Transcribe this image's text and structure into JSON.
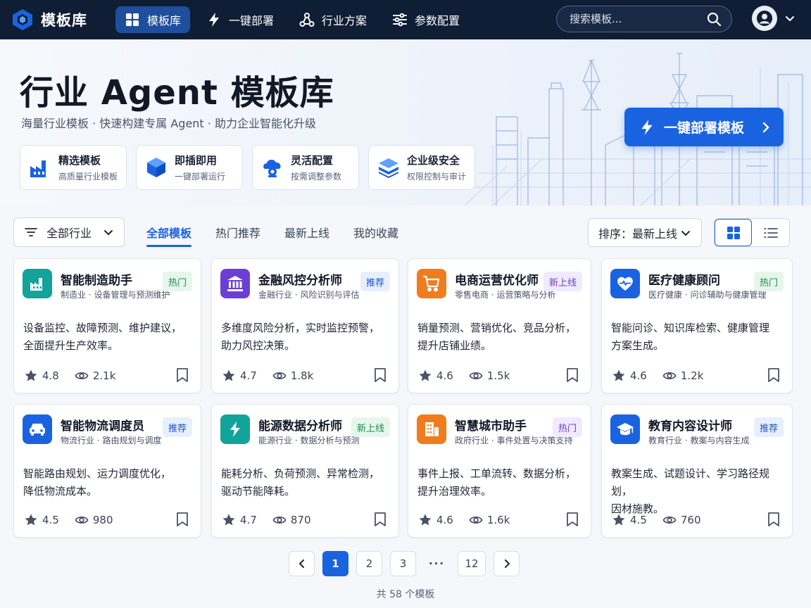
{
  "nav": {
    "brand": "模板库",
    "items": [
      {
        "label": "模板库",
        "icon": "grid-icon",
        "active": true
      },
      {
        "label": "一键部署",
        "icon": "bolt-icon",
        "active": false
      },
      {
        "label": "行业方案",
        "icon": "network-icon",
        "active": false
      },
      {
        "label": "参数配置",
        "icon": "sliders-icon",
        "active": false
      }
    ],
    "search_placeholder": "搜索模板..."
  },
  "hero": {
    "title": "行业 Agent 模板库",
    "subtitle": "海量行业模板 · 快速构建专属 Agent · 助力企业智能化升级",
    "cta": "一键部署模板",
    "features": [
      {
        "title": "精选模板",
        "desc": "高质量行业模板",
        "icon": "factory-icon"
      },
      {
        "title": "即插即用",
        "desc": "一键部署运行",
        "icon": "cube-icon"
      },
      {
        "title": "灵活配置",
        "desc": "按需调整参数",
        "icon": "settings-cloud-icon"
      },
      {
        "title": "企业级安全",
        "desc": "权限控制与审计",
        "icon": "layers-shield-icon"
      }
    ]
  },
  "filters": {
    "industry": "全部行业",
    "tabs": [
      "全部模板",
      "热门推荐",
      "最新上线",
      "我的收藏"
    ],
    "active_tab": 0,
    "sort": "排序：最新上线",
    "view": "grid"
  },
  "cards": [
    {
      "name": "智能制造助手",
      "category": "制造业 · 设备管理与预测维护",
      "badge": "热门",
      "desc1": "设备监控、故障预测、维护建议，",
      "desc2": "全面提升生产效率。",
      "rating": "4.8",
      "views": "2.1k",
      "icon": "factory-icon",
      "color": "#12a39a"
    },
    {
      "name": "金融风控分析师",
      "category": "金融行业 · 风险识别与评估",
      "badge": "推荐",
      "desc1": "多维度风险分析，实时监控预警，",
      "desc2": "助力风控决策。",
      "rating": "4.7",
      "views": "1.8k",
      "icon": "bank-icon",
      "color": "#6b3fd4"
    },
    {
      "name": "电商运营优化师",
      "category": "零售电商 · 运营策略与分析",
      "badge": "新上线",
      "desc1": "销量预测、营销优化、竞品分析，",
      "desc2": "提升店铺业绩。",
      "rating": "4.6",
      "views": "1.5k",
      "icon": "cart-icon",
      "color": "#f07c1e"
    },
    {
      "name": "医疗健康顾问",
      "category": "医疗健康 · 问诊辅助与健康管理",
      "badge": "热门",
      "desc1": "智能问诊、知识库检索、健康管理",
      "desc2": "方案生成。",
      "rating": "4.6",
      "views": "1.2k",
      "icon": "heart-icon",
      "color": "#1a63e0"
    },
    {
      "name": "智能物流调度员",
      "category": "物流行业 · 路由规划与调度",
      "badge": "推荐",
      "desc1": "智能路由规划、运力调度优化，",
      "desc2": "降低物流成本。",
      "rating": "4.5",
      "views": "980",
      "icon": "truck-icon",
      "color": "#1a63e0"
    },
    {
      "name": "能源数据分析师",
      "category": "能源行业 · 数据分析与预测",
      "badge": "新上线",
      "desc1": "能耗分析、负荷预测、异常检测，",
      "desc2": "驱动节能降耗。",
      "rating": "4.7",
      "views": "870",
      "icon": "energy-icon",
      "color": "#12a39a"
    },
    {
      "name": "智慧城市助手",
      "category": "政府行业 · 事件处置与决策支持",
      "badge": "热门",
      "desc1": "事件上报、工单流转、数据分析，",
      "desc2": "提升治理效率。",
      "rating": "4.6",
      "views": "1.6k",
      "icon": "building-icon",
      "color": "#f07c1e"
    },
    {
      "name": "教育内容设计师",
      "category": "教育行业 · 教案与内容生成",
      "badge": "推荐",
      "desc1": "教案生成、试题设计、学习路径规划，",
      "desc2": "因材施教。",
      "rating": "4.5",
      "views": "760",
      "icon": "graduation-icon",
      "color": "#1a63e0"
    }
  ],
  "pagination": {
    "pages": [
      "1",
      "2",
      "3",
      "···",
      "12"
    ],
    "current": "1",
    "total": "共 58 个模板"
  }
}
